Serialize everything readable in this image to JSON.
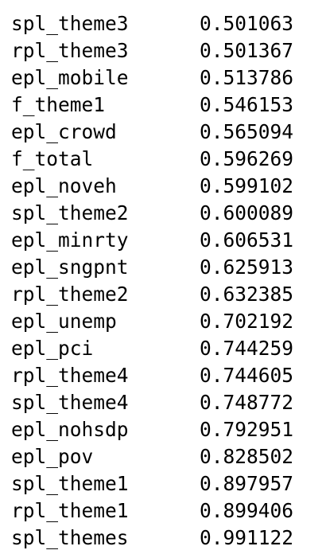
{
  "series_output": {
    "rows": [
      {
        "name": "spl_theme3",
        "value": "0.501063"
      },
      {
        "name": "rpl_theme3",
        "value": "0.501367"
      },
      {
        "name": "epl_mobile",
        "value": "0.513786"
      },
      {
        "name": "f_theme1",
        "value": "0.546153"
      },
      {
        "name": "epl_crowd",
        "value": "0.565094"
      },
      {
        "name": "f_total",
        "value": "0.596269"
      },
      {
        "name": "epl_noveh",
        "value": "0.599102"
      },
      {
        "name": "spl_theme2",
        "value": "0.600089"
      },
      {
        "name": "epl_minrty",
        "value": "0.606531"
      },
      {
        "name": "epl_sngpnt",
        "value": "0.625913"
      },
      {
        "name": "rpl_theme2",
        "value": "0.632385"
      },
      {
        "name": "epl_unemp",
        "value": "0.702192"
      },
      {
        "name": "epl_pci",
        "value": "0.744259"
      },
      {
        "name": "rpl_theme4",
        "value": "0.744605"
      },
      {
        "name": "spl_theme4",
        "value": "0.748772"
      },
      {
        "name": "epl_nohsdp",
        "value": "0.792951"
      },
      {
        "name": "epl_pov",
        "value": "0.828502"
      },
      {
        "name": "spl_theme1",
        "value": "0.897957"
      },
      {
        "name": "rpl_theme1",
        "value": "0.899406"
      },
      {
        "name": "spl_themes",
        "value": "0.991122"
      }
    ]
  }
}
